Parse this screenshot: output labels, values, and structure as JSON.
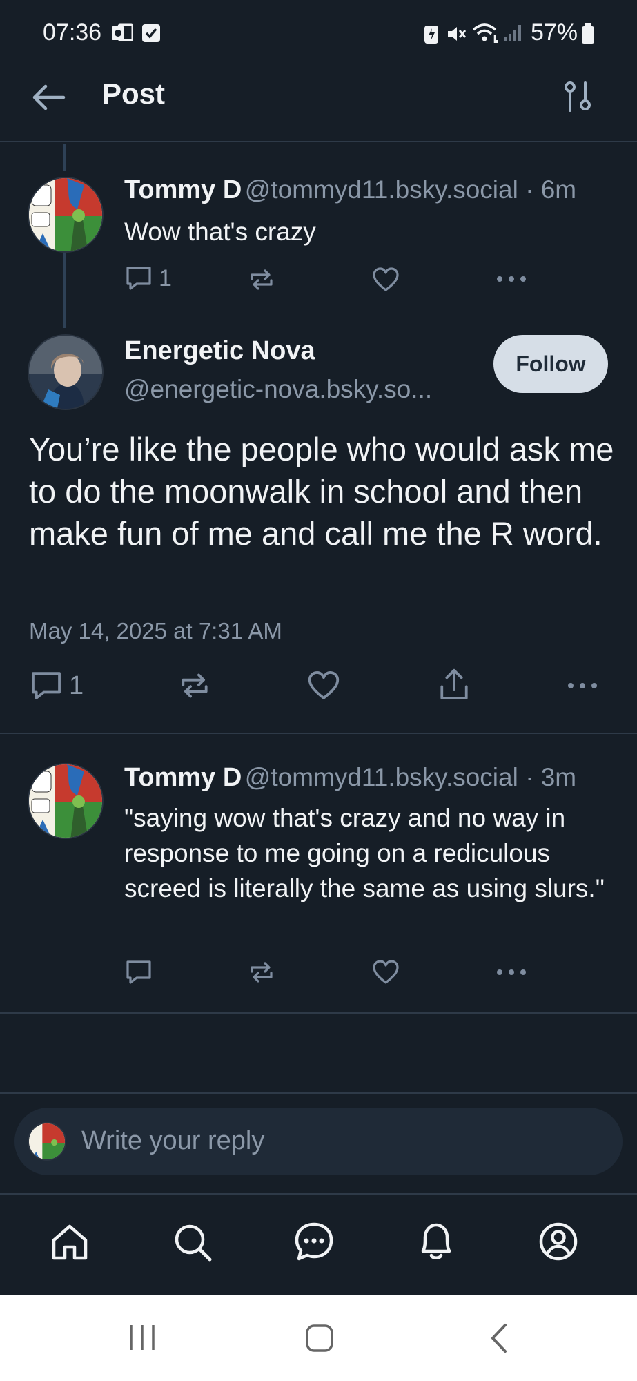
{
  "status_bar": {
    "time": "07:36",
    "battery": "57%"
  },
  "header": {
    "title": "Post"
  },
  "posts": [
    {
      "author": "Tommy D",
      "handle": "@tommyd11.bsky.social · 6m",
      "text": "Wow that's crazy",
      "reply_count": "1"
    },
    {
      "author": "Energetic Nova",
      "handle": "@energetic-nova.bsky.so...",
      "follow_label": "Follow",
      "text": "You’re like the people who would ask me to do the moonwalk in school and then make fun of me and call me the R word.",
      "timestamp": "May 14, 2025 at 7:31 AM",
      "reply_count": "1"
    },
    {
      "author": "Tommy D",
      "handle": "@tommyd11.bsky.social · 3m",
      "text": "\"saying wow that's crazy and no way in response to me going on a rediculous screed is literally the same as using slurs.\""
    }
  ],
  "composer": {
    "placeholder": "Write your reply"
  },
  "icons": {
    "back": "arrow-left-icon",
    "settings": "sliders-icon",
    "reply": "comment-icon",
    "repost": "repost-icon",
    "like": "heart-icon",
    "share": "share-icon",
    "more": "ellipsis-icon",
    "home": "home-icon",
    "search": "search-icon",
    "chat": "chat-icon",
    "notifications": "bell-icon",
    "profile": "profile-icon"
  },
  "colors": {
    "background": "#161e27",
    "follow_button": "#d6dee7",
    "muted_text": "#8b98a8"
  }
}
